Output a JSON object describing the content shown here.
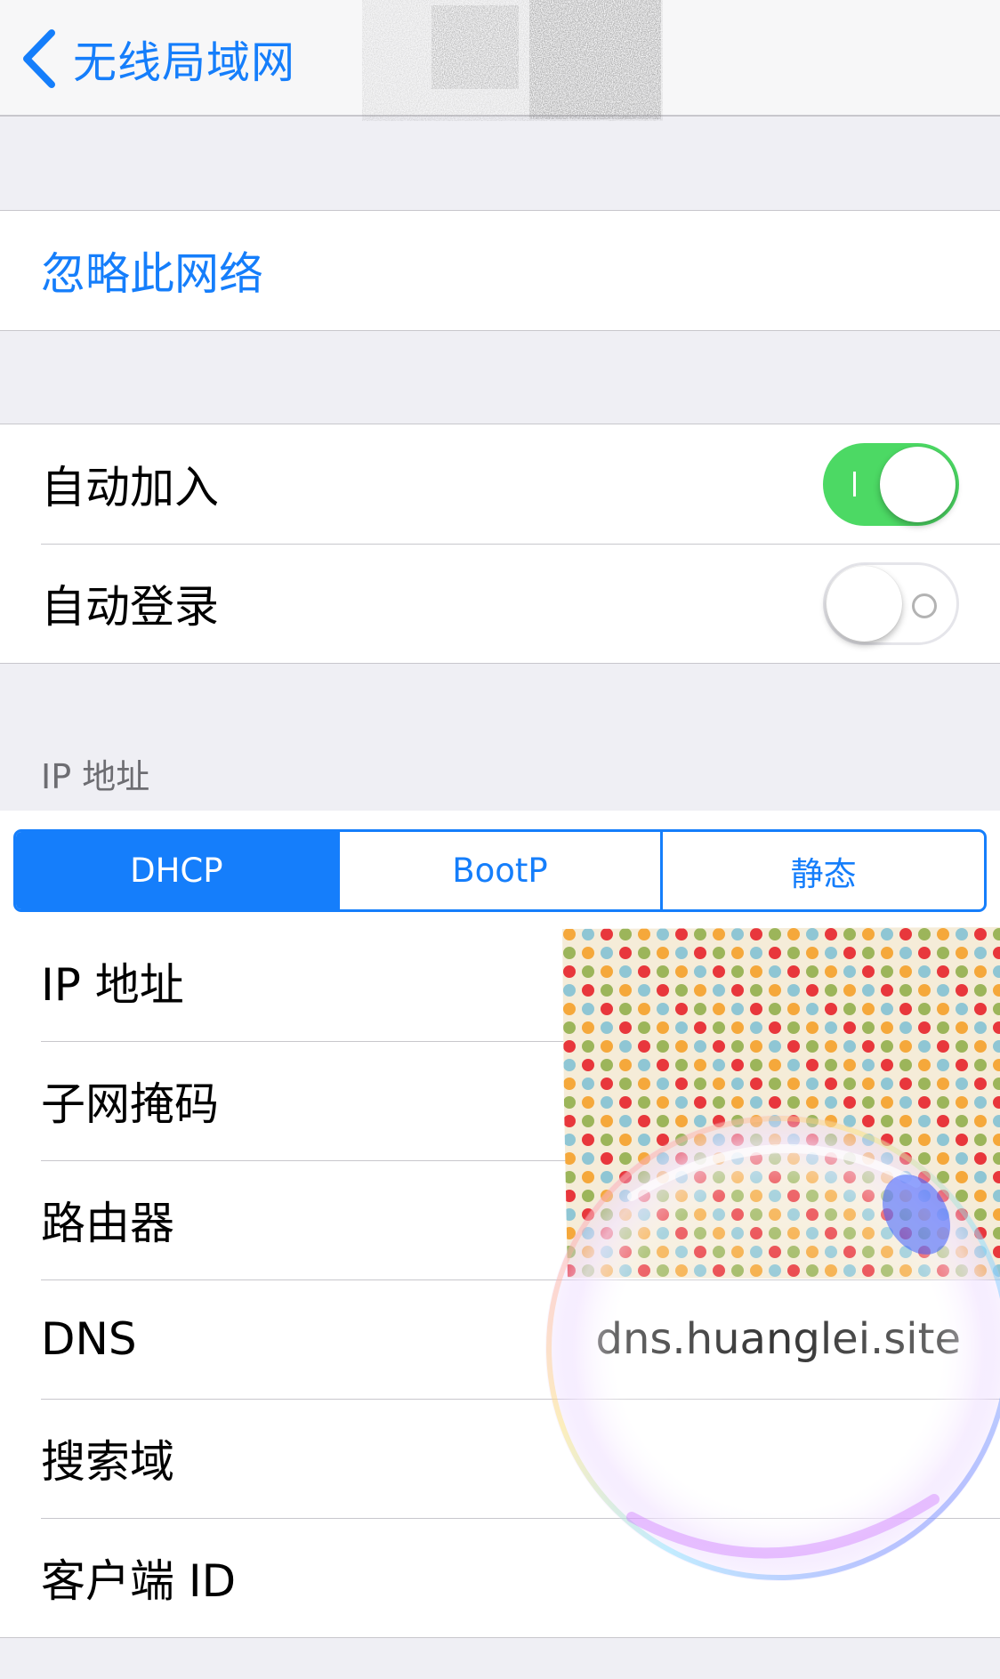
{
  "navbar": {
    "back_label": "无线局域网",
    "colors": {
      "tint": "#157efb",
      "bar": "#f7f7f8"
    }
  },
  "forget_network": {
    "label": "忽略此网络"
  },
  "auto_join": {
    "label": "自动加入",
    "on": true
  },
  "auto_login": {
    "label": "自动登录",
    "on": false
  },
  "ip_section": {
    "header": "IP 地址",
    "segments": [
      "DHCP",
      "BootP",
      "静态"
    ],
    "selected": "DHCP"
  },
  "details": {
    "ip_address": {
      "label": "IP 地址",
      "value": ""
    },
    "subnet_mask": {
      "label": "子网掩码",
      "value": ""
    },
    "router": {
      "label": "路由器",
      "value": ""
    },
    "dns": {
      "label": "DNS",
      "value": "dns.huanglei.site"
    },
    "search_domains": {
      "label": "搜索域",
      "value": ""
    },
    "client_id": {
      "label": "客户端 ID",
      "value": ""
    }
  },
  "colors": {
    "accent": "#157efb",
    "switch_on": "#4cd964",
    "background": "#efeff4"
  }
}
